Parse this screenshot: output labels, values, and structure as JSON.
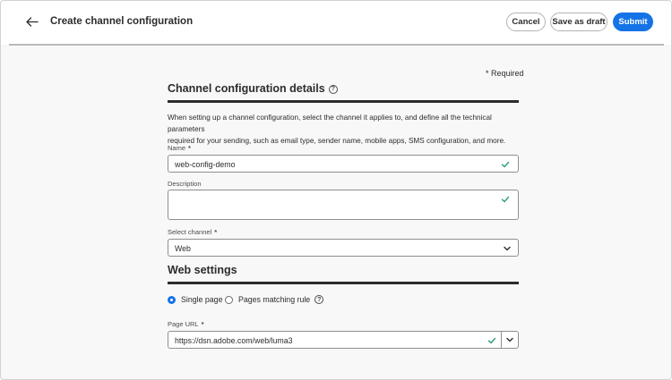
{
  "header": {
    "title": "Create channel configuration",
    "cancel_label": "Cancel",
    "draft_label": "Save as draft",
    "submit_label": "Submit"
  },
  "form": {
    "required_note": "* Required",
    "section_title": "Channel configuration details",
    "intro_line1": "When setting up a channel configuration, select the channel it applies to, and define all the technical parameters",
    "intro_line2": "required for your sending, such as email type, sender name, mobile apps, SMS configuration, and more.",
    "name": {
      "label": "Name",
      "required_mark": "*",
      "value": "web-config-demo",
      "valid": true
    },
    "description": {
      "label": "Description",
      "value": "",
      "valid": true
    },
    "channel": {
      "label": "Select channel",
      "required_mark": "*",
      "value": "Web"
    }
  },
  "web_settings": {
    "title": "Web settings",
    "options": [
      {
        "label": "Single page",
        "selected": true
      },
      {
        "label": "Pages matching rule",
        "selected": false
      }
    ],
    "page_url": {
      "label": "Page URL",
      "required_mark": "*",
      "value": "https://dsn.adobe.com/web/luma3",
      "valid": true
    }
  },
  "colors": {
    "accent": "#1473e6",
    "valid_check": "#2d9d78",
    "text": "#2c2c2c"
  }
}
